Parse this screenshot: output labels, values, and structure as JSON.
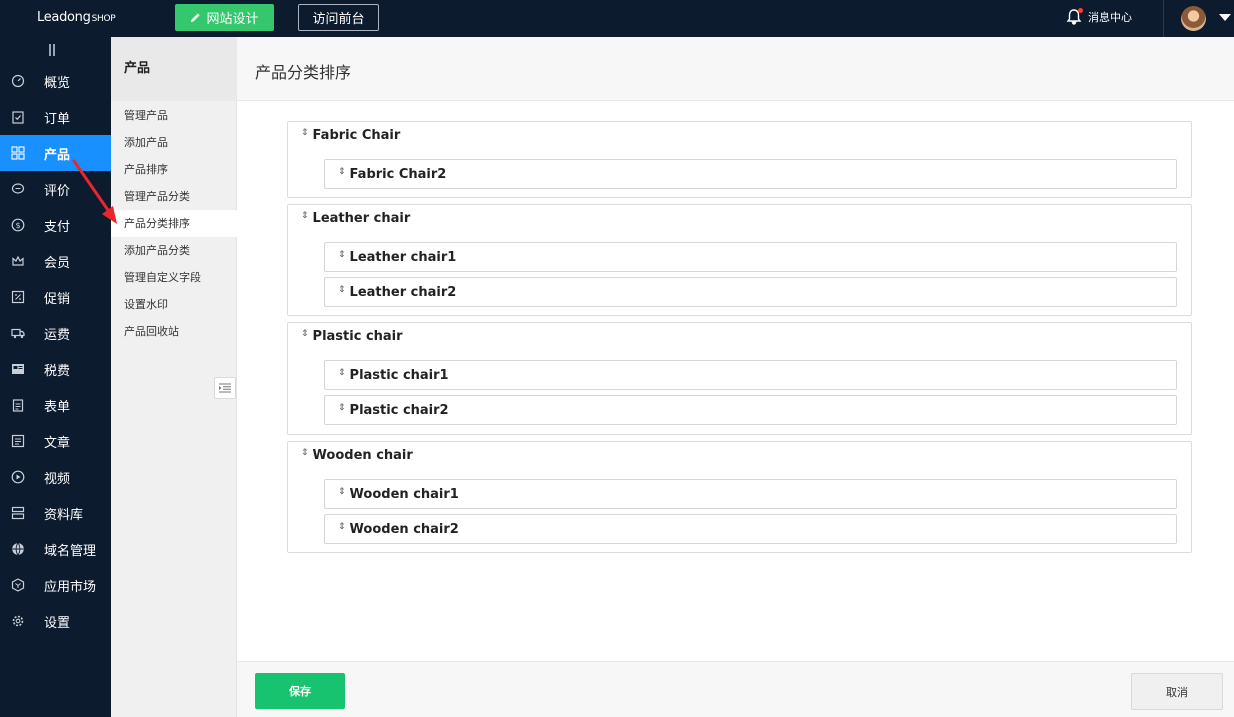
{
  "topbar": {
    "logo_main": "Leadong",
    "logo_shop": "SHOP",
    "design_button": "网站设计",
    "visit_button": "访问前台",
    "message_center": "消息中心"
  },
  "sidebar": {
    "items": [
      {
        "label": "概览",
        "icon": "gauge-icon"
      },
      {
        "label": "订单",
        "icon": "clipboard-check-icon"
      },
      {
        "label": "产品",
        "icon": "grid-icon",
        "active": true
      },
      {
        "label": "评价",
        "icon": "chat-icon"
      },
      {
        "label": "支付",
        "icon": "dollar-icon"
      },
      {
        "label": "会员",
        "icon": "crown-icon"
      },
      {
        "label": "促销",
        "icon": "percent-tag-icon"
      },
      {
        "label": "运费",
        "icon": "truck-icon"
      },
      {
        "label": "税费",
        "icon": "tax-icon"
      },
      {
        "label": "表单",
        "icon": "form-icon"
      },
      {
        "label": "文章",
        "icon": "article-icon"
      },
      {
        "label": "视频",
        "icon": "play-icon"
      },
      {
        "label": "资料库",
        "icon": "database-icon"
      },
      {
        "label": "域名管理",
        "icon": "globe-icon"
      },
      {
        "label": "应用市场",
        "icon": "cube-icon"
      },
      {
        "label": "设置",
        "icon": "gear-icon"
      }
    ]
  },
  "subnav": {
    "title": "产品",
    "items": [
      "管理产品",
      "添加产品",
      "产品排序",
      "管理产品分类",
      "产品分类排序",
      "添加产品分类",
      "管理自定义字段",
      "设置水印",
      "产品回收站"
    ],
    "active_index": 4
  },
  "main": {
    "title": "产品分类排序",
    "categories": [
      {
        "name": "Fabric Chair",
        "children": [
          "Fabric Chair2"
        ]
      },
      {
        "name": "Leather chair",
        "children": [
          "Leather chair1",
          "Leather chair2"
        ]
      },
      {
        "name": "Plastic chair",
        "children": [
          "Plastic chair1",
          "Plastic chair2"
        ]
      },
      {
        "name": "Wooden chair",
        "children": [
          "Wooden chair1",
          "Wooden chair2"
        ]
      }
    ]
  },
  "footer": {
    "save_label": "保存",
    "cancel_label": "取消"
  },
  "colors": {
    "nav_bg": "#0d1b2e",
    "active_blue": "#1890ff",
    "green": "#35c76e",
    "save_green": "#17c36e",
    "annotation_red": "#e8262b"
  }
}
